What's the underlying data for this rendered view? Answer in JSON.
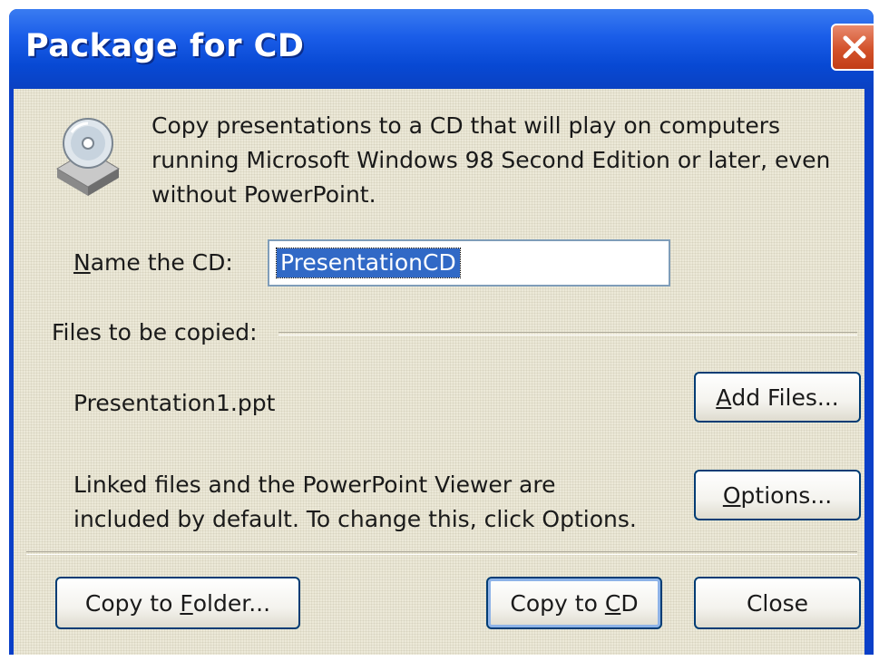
{
  "window": {
    "title": "Package for CD"
  },
  "intro": {
    "line1": "Copy presentations to a CD that will play on computers",
    "line2": "running Microsoft Windows 98 Second Edition or later, even",
    "line3": "without PowerPoint."
  },
  "name_field": {
    "label_key": "N",
    "label_rest": "ame the CD:",
    "value": "PresentationCD"
  },
  "files_section": {
    "label": "Files to be copied:",
    "file": "Presentation1.ppt",
    "note_line1": "Linked files and the PowerPoint Viewer are",
    "note_line2": "included by default. To change this, click Options."
  },
  "buttons": {
    "add_files": {
      "key": "A",
      "rest": "dd Files..."
    },
    "options": {
      "key": "O",
      "rest": "ptions..."
    },
    "copy_folder": {
      "pre": "Copy to ",
      "key": "F",
      "rest": "older..."
    },
    "copy_cd": {
      "pre": "Copy to ",
      "key": "C",
      "rest": "D"
    },
    "close": "Close"
  },
  "icons": {
    "window_close": "close-icon",
    "cd_drive": "cd-drive-icon"
  },
  "colors": {
    "titlebar": "#0a49d4",
    "dialog_bg": "#ece9d8",
    "selection": "#3169c6",
    "close_button": "#d3522b"
  }
}
